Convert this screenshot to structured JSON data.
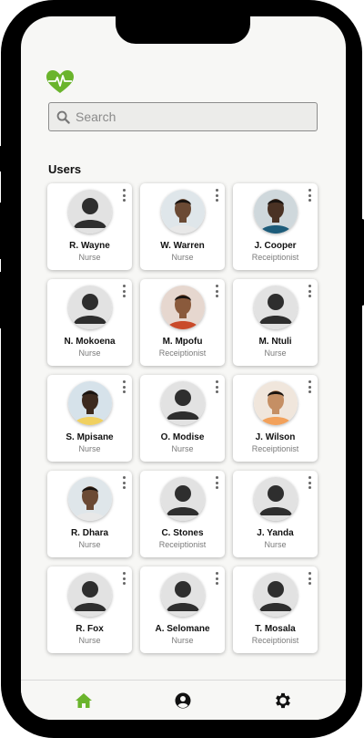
{
  "search": {
    "placeholder": "Search",
    "value": ""
  },
  "section_title": "Users",
  "colors": {
    "accent": "#6ab42c",
    "icon_dark": "#111111",
    "placeholder_avatar_bg": "#e2e2e2"
  },
  "users": [
    {
      "name": "R. Wayne",
      "role": "Nurse",
      "avatar": "placeholder"
    },
    {
      "name": "W. Warren",
      "role": "Nurse",
      "avatar": "photo"
    },
    {
      "name": "J. Cooper",
      "role": "Receiptionist",
      "avatar": "photo"
    },
    {
      "name": "N. Mokoena",
      "role": "Nurse",
      "avatar": "placeholder"
    },
    {
      "name": "M. Mpofu",
      "role": "Receiptionist",
      "avatar": "photo"
    },
    {
      "name": "M. Ntuli",
      "role": "Nurse",
      "avatar": "placeholder"
    },
    {
      "name": "S. Mpisane",
      "role": "Nurse",
      "avatar": "photo"
    },
    {
      "name": "O. Modise",
      "role": "Nurse",
      "avatar": "placeholder"
    },
    {
      "name": "J. Wilson",
      "role": "Receiptionist",
      "avatar": "photo"
    },
    {
      "name": "R. Dhara",
      "role": "Nurse",
      "avatar": "photo"
    },
    {
      "name": "C. Stones",
      "role": "Receiptionist",
      "avatar": "placeholder"
    },
    {
      "name": "J. Yanda",
      "role": "Nurse",
      "avatar": "placeholder"
    },
    {
      "name": "R. Fox",
      "role": "Nurse",
      "avatar": "placeholder"
    },
    {
      "name": "A. Selomane",
      "role": "Nurse",
      "avatar": "placeholder"
    },
    {
      "name": "T. Mosala",
      "role": "Receiptionist",
      "avatar": "placeholder"
    }
  ],
  "nav": [
    {
      "icon": "home-icon",
      "active": true
    },
    {
      "icon": "profile-icon",
      "active": false
    },
    {
      "icon": "gear-icon",
      "active": false
    }
  ]
}
